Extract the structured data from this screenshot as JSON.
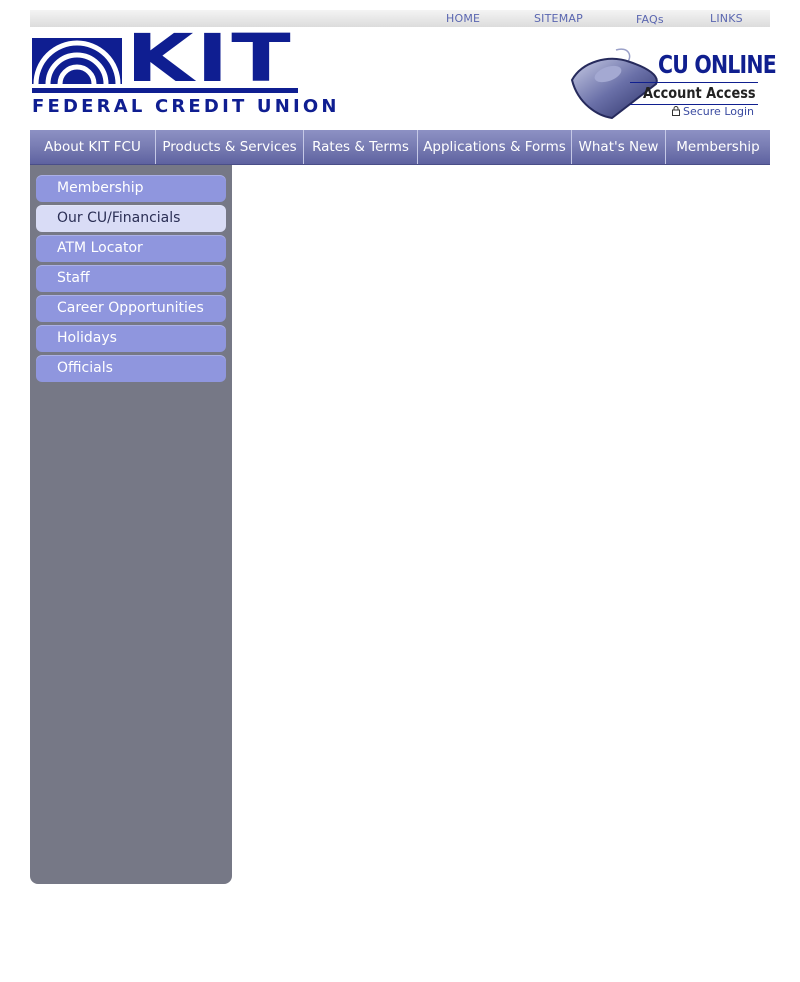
{
  "top_links": [
    {
      "label": "HOME"
    },
    {
      "label": "SITEMAP"
    },
    {
      "label": "FAQs"
    },
    {
      "label": "LINKS"
    }
  ],
  "logo": {
    "wordmark": "KIT",
    "subtitle": "FEDERAL CREDIT UNION",
    "brand_color": "#0f1e91"
  },
  "cu_online": {
    "title": "CU ONLINE",
    "subtitle": "Account Access",
    "login_label": "Secure Login",
    "icon": "mouse-icon"
  },
  "main_nav": [
    {
      "label": "About KIT FCU"
    },
    {
      "label": "Products & Services"
    },
    {
      "label": "Rates & Terms"
    },
    {
      "label": "Applications & Forms"
    },
    {
      "label": "What's New"
    },
    {
      "label": "Membership"
    }
  ],
  "sidebar": {
    "active_item": "Our CU/Financials",
    "items": [
      {
        "label": "Membership"
      },
      {
        "label": "Our CU/Financials"
      },
      {
        "label": "ATM Locator"
      },
      {
        "label": "Staff"
      },
      {
        "label": "Career Opportunities"
      },
      {
        "label": "Holidays"
      },
      {
        "label": "Officials"
      }
    ]
  },
  "colors": {
    "nav_bar": "#7a7eb4",
    "sidebar_bg": "#767886",
    "sidebar_item": "#8f96de",
    "sidebar_item_active": "#d9dcf6",
    "link": "#5a66b0"
  }
}
